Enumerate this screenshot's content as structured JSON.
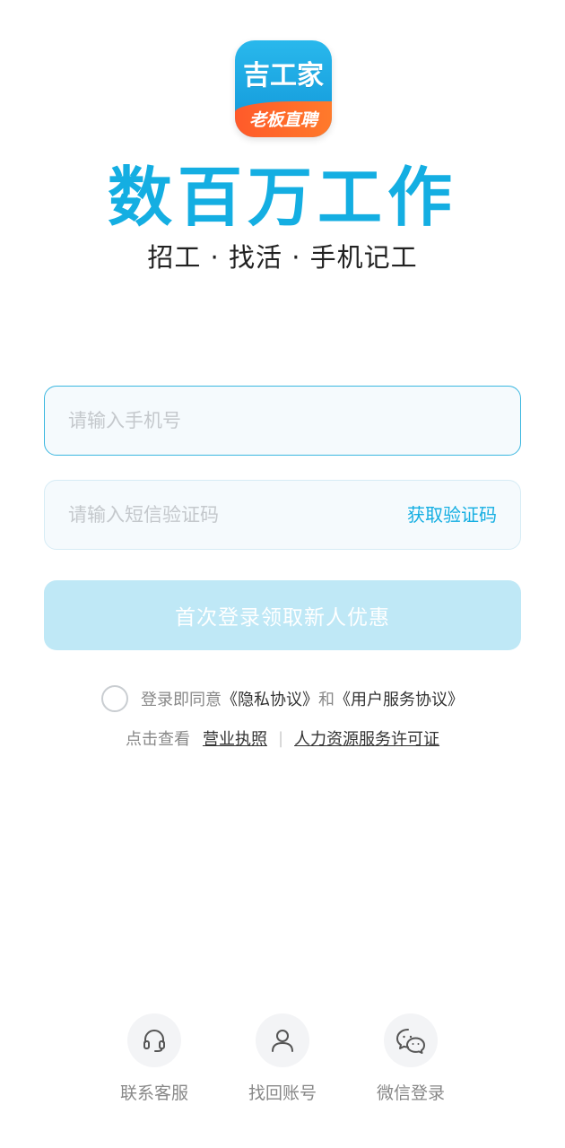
{
  "logo": {
    "top_text": "吉工家",
    "bottom_text": "老板直聘"
  },
  "slogan": "数百万工作",
  "subtitle": "招工 · 找活 · 手机记工",
  "phone_input": {
    "placeholder": "请输入手机号",
    "value": ""
  },
  "code_input": {
    "placeholder": "请输入短信验证码",
    "value": "",
    "get_code_label": "获取验证码"
  },
  "login_button": "首次登录领取新人优惠",
  "agreement": {
    "checked": false,
    "prefix": "登录即同意",
    "privacy": "《隐私协议》",
    "and": "和",
    "service": "《用户服务协议》"
  },
  "license": {
    "prefix": "点击查看",
    "business_license": "营业执照",
    "hr_license": "人力资源服务许可证"
  },
  "bottom_actions": [
    {
      "label": "联系客服",
      "icon": "headset-icon"
    },
    {
      "label": "找回账号",
      "icon": "user-icon"
    },
    {
      "label": "微信登录",
      "icon": "wechat-icon"
    }
  ],
  "colors": {
    "accent": "#14aee2",
    "button_disabled": "#bfe8f6",
    "logo_orange": "#ff6a2a"
  }
}
